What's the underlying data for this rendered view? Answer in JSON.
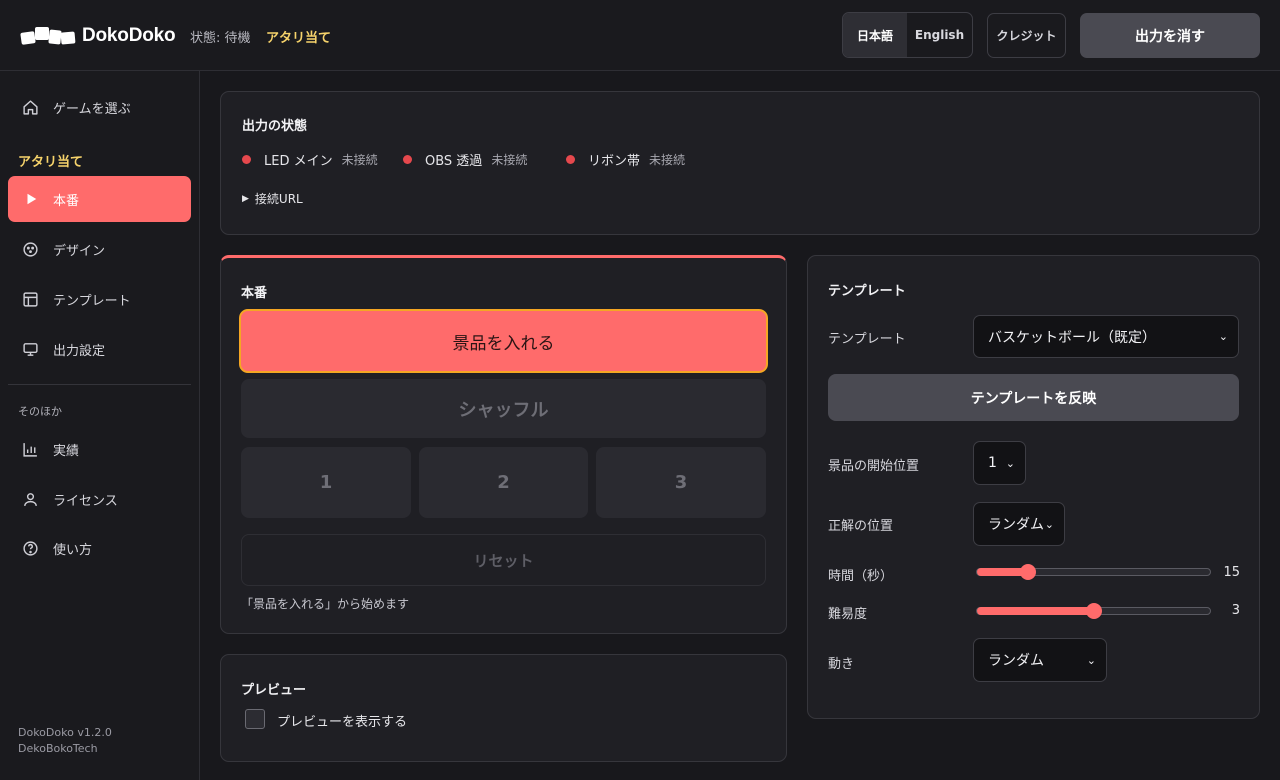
{
  "header": {
    "brand": "DokoDoko",
    "status_text": "状態: 待機",
    "mode": "アタリ当て",
    "lang_ja": "日本語",
    "lang_en": "English",
    "credit": "クレジット",
    "clear_output": "出力を消す"
  },
  "sidebar": {
    "choose_game": "ゲームを選ぶ",
    "section_main": "アタリ当て",
    "items": [
      {
        "label": "本番",
        "icon": "play-icon"
      },
      {
        "label": "デザイン",
        "icon": "palette-icon"
      },
      {
        "label": "テンプレート",
        "icon": "layout-icon"
      },
      {
        "label": "出力設定",
        "icon": "monitor-icon"
      }
    ],
    "section_other": "そのほか",
    "other_items": [
      {
        "label": "実績",
        "icon": "bar-chart-icon"
      },
      {
        "label": "ライセンス",
        "icon": "user-icon"
      },
      {
        "label": "使い方",
        "icon": "help-icon"
      }
    ],
    "version": "DokoDoko v1.2.0",
    "company": "DekoBokoTech"
  },
  "output_status": {
    "title": "出力の状態",
    "items": [
      {
        "name": "LED メイン",
        "state": "未接続",
        "color": "#e5484d"
      },
      {
        "name": "OBS 透過",
        "state": "未接続",
        "color": "#e5484d"
      },
      {
        "name": "リボン帯",
        "state": "未接続",
        "color": "#e5484d"
      }
    ],
    "connection_url": "接続URL"
  },
  "production": {
    "title": "本番",
    "insert_prize": "景品を入れる",
    "shuffle": "シャッフル",
    "choices": [
      "1",
      "2",
      "3"
    ],
    "reset": "リセット",
    "hint": "「景品を入れる」から始めます"
  },
  "preview": {
    "title": "プレビュー",
    "show_preview": "プレビューを表示する",
    "checked": false
  },
  "template": {
    "title": "テンプレート",
    "template_label": "テンプレート",
    "template_value": "バスケットボール（既定）",
    "apply": "テンプレートを反映",
    "start_pos_label": "景品の開始位置",
    "start_pos_value": "1",
    "answer_pos_label": "正解の位置",
    "answer_pos_value": "ランダム",
    "time_label": "時間（秒）",
    "time_value": "15",
    "time_fraction": 0.22,
    "difficulty_label": "難易度",
    "difficulty_value": "3",
    "difficulty_fraction": 0.5,
    "motion_label": "動き",
    "motion_value": "ランダム"
  },
  "colors": {
    "accent": "#ff6b6b",
    "highlight": "#f6d36b",
    "status_off": "#e5484d"
  }
}
